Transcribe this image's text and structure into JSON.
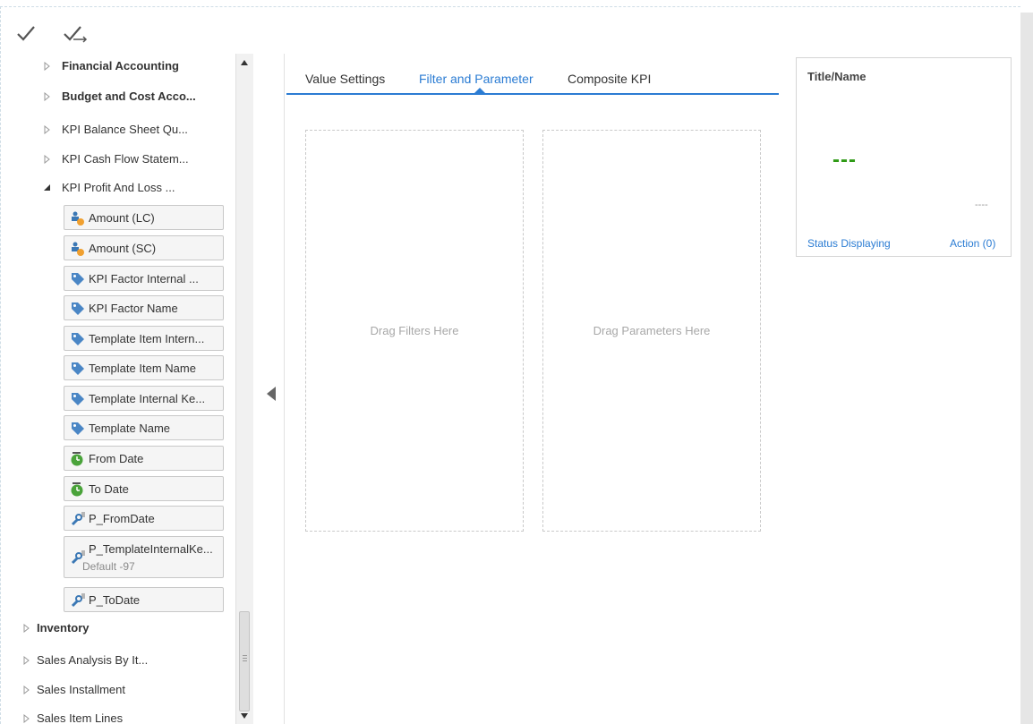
{
  "toolbar": {
    "apply_icon": "checkmark-icon",
    "apply_next_icon": "checkmark-arrow-icon"
  },
  "tree": {
    "nodes_top": [
      {
        "label": "Financial Accounting",
        "bold": true,
        "state": "collapsed"
      },
      {
        "label": "Budget and Cost Acco...",
        "bold": true,
        "state": "collapsed"
      },
      {
        "label": "KPI Balance Sheet Qu...",
        "bold": false,
        "state": "collapsed"
      },
      {
        "label": "KPI Cash Flow Statem...",
        "bold": false,
        "state": "collapsed"
      },
      {
        "label": "KPI Profit And Loss ...",
        "bold": false,
        "state": "expanded"
      }
    ],
    "fields": [
      {
        "label": "Amount (LC)",
        "icon": "measure-icon"
      },
      {
        "label": "Amount (SC)",
        "icon": "measure-icon"
      },
      {
        "label": "KPI Factor Internal ...",
        "icon": "tag-icon"
      },
      {
        "label": "KPI Factor Name",
        "icon": "tag-icon"
      },
      {
        "label": "Template Item Intern...",
        "icon": "tag-icon"
      },
      {
        "label": "Template Item Name",
        "icon": "tag-icon"
      },
      {
        "label": "Template Internal Ke...",
        "icon": "tag-icon"
      },
      {
        "label": "Template Name",
        "icon": "tag-icon"
      },
      {
        "label": "From Date",
        "icon": "date-icon"
      },
      {
        "label": "To Date",
        "icon": "date-icon"
      },
      {
        "label": "P_FromDate",
        "icon": "parameter-icon"
      },
      {
        "label": "P_TemplateInternalKe...",
        "sub": "Default -97",
        "icon": "parameter-icon"
      },
      {
        "label": "P_ToDate",
        "icon": "parameter-icon"
      }
    ],
    "nodes_bottom": [
      {
        "label": "Inventory",
        "bold": true,
        "state": "collapsed"
      },
      {
        "label": "Sales Analysis By It...",
        "bold": false,
        "state": "collapsed"
      },
      {
        "label": "Sales Installment",
        "bold": false,
        "state": "collapsed"
      },
      {
        "label": "Sales Item Lines",
        "bold": false,
        "state": "collapsed"
      }
    ]
  },
  "tabs": [
    {
      "label": "Value Settings",
      "active": false
    },
    {
      "label": "Filter and Parameter",
      "active": true
    },
    {
      "label": "Composite KPI",
      "active": false
    }
  ],
  "dropzones": {
    "filters": "Drag Filters Here",
    "parameters": "Drag Parameters Here"
  },
  "kpi_tile": {
    "title": "Title/Name",
    "value": "---",
    "target": "----",
    "status": "Status Displaying",
    "action": "Action (0)",
    "value_color": "#2e9a15"
  },
  "colors": {
    "accent": "#2b7cd3",
    "field_bg": "#f5f5f5"
  }
}
